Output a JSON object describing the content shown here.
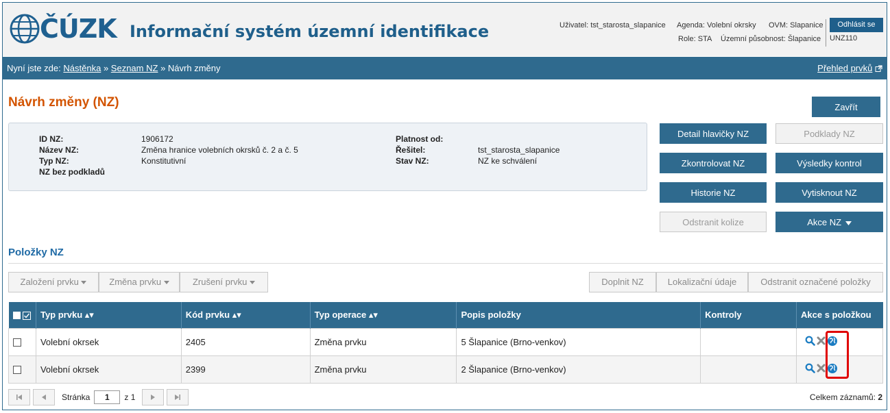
{
  "header": {
    "logo_text": "ČÚZK",
    "title": "Informační systém územní identifikace",
    "user_label": "Uživatel: tst_starosta_slapanice",
    "agenda_label": "Agenda: Volební okrsky",
    "ovm_label": "OVM: Slapanice",
    "role_label": "Role: STA",
    "uzemni_label": "Územní působnost: Šlapanice",
    "logout_label": "Odhlásit se",
    "unz_label": "UNZ110"
  },
  "breadcrumb": {
    "prefix": "Nyní jste zde:",
    "items": [
      "Nástěnka",
      "Seznam NZ",
      "Návrh změny"
    ],
    "separator": "»",
    "right_link": "Přehled prvků"
  },
  "page": {
    "title": "Návrh změny (NZ)",
    "close_label": "Zavřít"
  },
  "info": {
    "id_label": "ID NZ:",
    "id_value": "1906172",
    "nazev_label": "Název NZ:",
    "nazev_value": "Změna hranice volebních okrsků č. 2 a č. 5",
    "typ_label": "Typ NZ:",
    "typ_value": "Konstitutivní",
    "bez_podkladu_label": "NZ bez podkladů",
    "platnost_label": "Platnost od:",
    "platnost_value": "",
    "resitel_label": "Řešitel:",
    "resitel_value": "tst_starosta_slapanice",
    "stav_label": "Stav NZ:",
    "stav_value": "NZ ke schválení"
  },
  "actions": {
    "detail": "Detail hlavičky NZ",
    "podklady": "Podklady NZ",
    "zkontrolovat": "Zkontrolovat NZ",
    "vysledky": "Výsledky kontrol",
    "historie": "Historie NZ",
    "vytisknout": "Vytisknout NZ",
    "odstranit_kolize": "Odstranit kolize",
    "akce": "Akce NZ"
  },
  "section": {
    "title": "Položky NZ"
  },
  "toolbar": {
    "zalozeni": "Založení prvku",
    "zmena": "Změna prvku",
    "zruseni": "Zrušení prvku",
    "doplnit": "Doplnit NZ",
    "lokalizacni": "Lokalizační údaje",
    "odstranit": "Odstranit označené položky"
  },
  "table": {
    "columns": [
      "Typ prvku",
      "Kód prvku",
      "Typ operace",
      "Popis položky",
      "Kontroly",
      "Akce s položkou"
    ],
    "rows": [
      {
        "typ": "Volební okrsek",
        "kod": "2405",
        "operace": "Změna prvku",
        "popis": "5 Šlapanice (Brno-venkov)",
        "kontroly": ""
      },
      {
        "typ": "Volební okrsek",
        "kod": "2399",
        "operace": "Změna prvku",
        "popis": "2 Šlapanice (Brno-venkov)",
        "kontroly": ""
      }
    ]
  },
  "pager": {
    "page_label": "Stránka",
    "page_value": "1",
    "of_label": "z 1",
    "total_label": "Celkem záznamů:",
    "total_value": "2"
  },
  "colors": {
    "primary": "#2f6a8e",
    "title_orange": "#d35400",
    "highlight_red": "#e00000"
  }
}
